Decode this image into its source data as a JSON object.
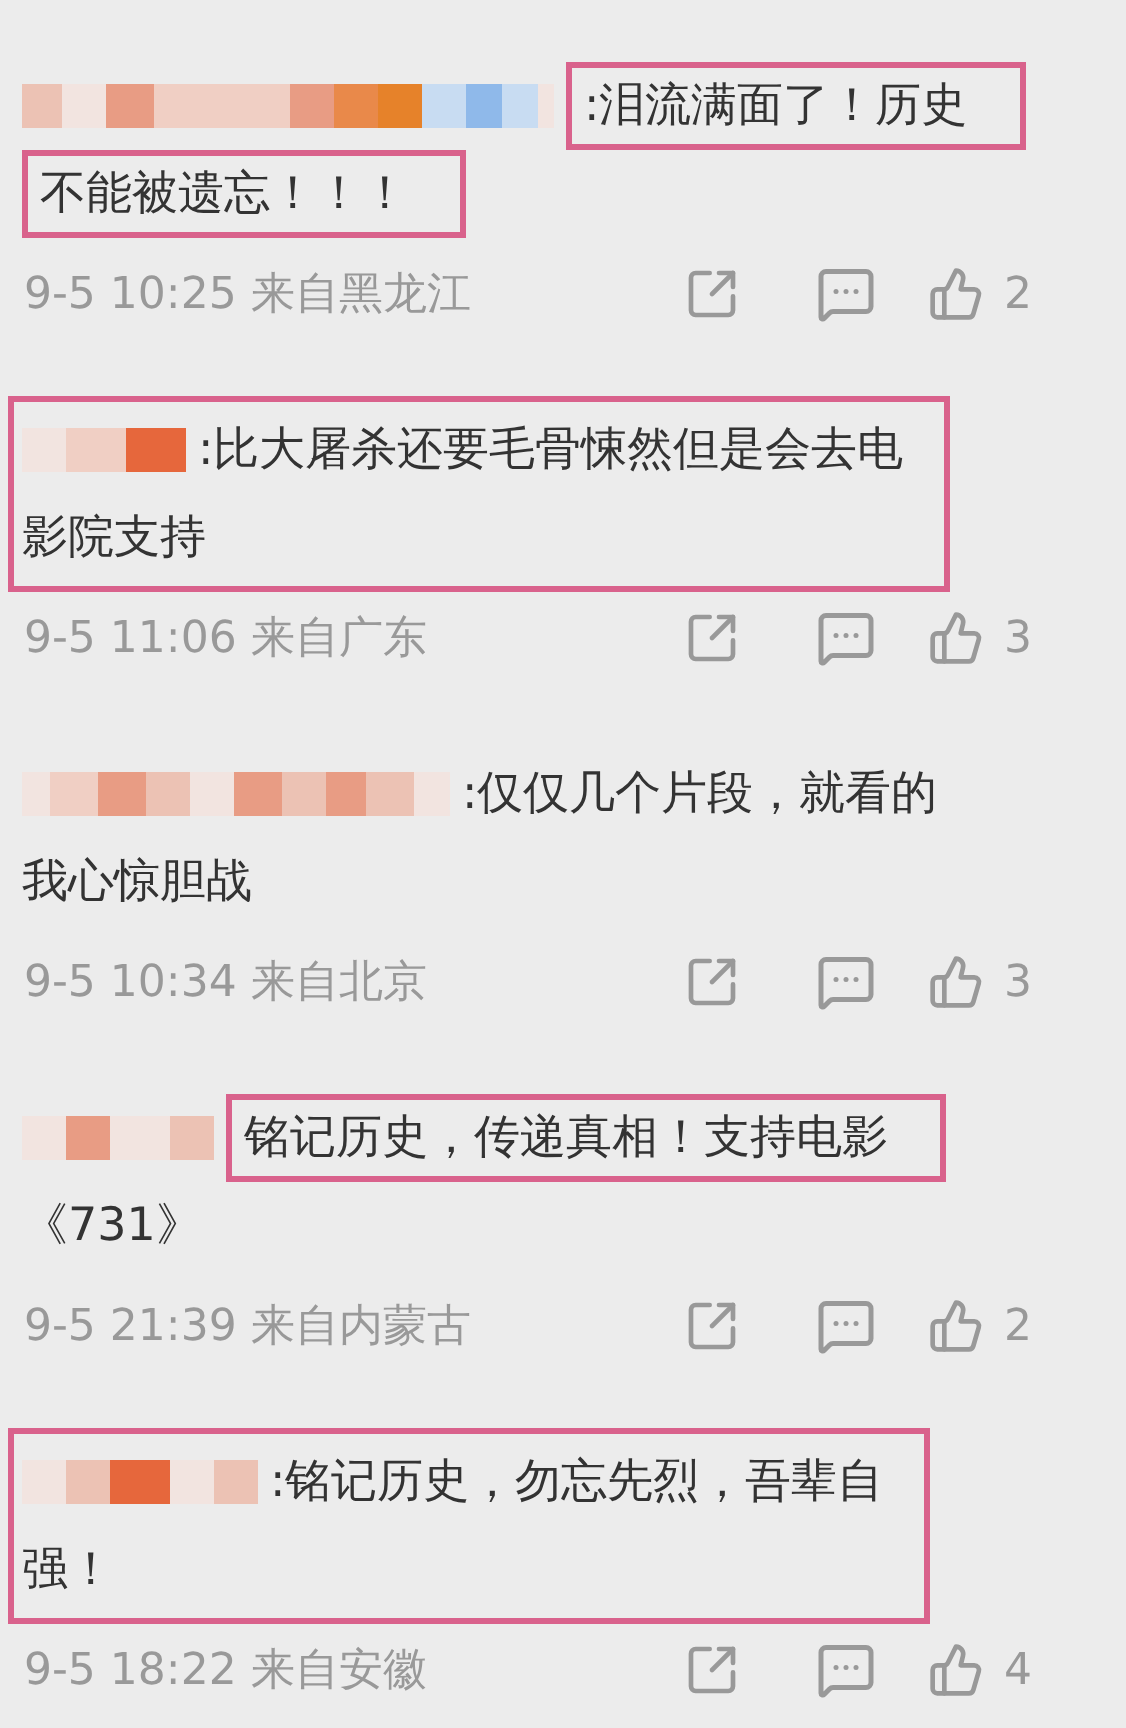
{
  "comments": [
    {
      "author": {
        "kind": "pixelated"
      },
      "merged": false,
      "lines": [
        {
          "text": ":泪流满面了！历史",
          "marked": true
        },
        {
          "text": "不能被遗忘！！！",
          "marked": true
        }
      ],
      "meta": "9-5 10:25 来自黑龙江",
      "likes": "2"
    },
    {
      "author": {
        "kind": "pixelated"
      },
      "merged": true,
      "lines": [
        {
          "text": ":比大屠杀还要毛骨悚然但是会去电"
        },
        {
          "text": "影院支持"
        }
      ],
      "meta": "9-5 11:06 来自广东",
      "likes": "3"
    },
    {
      "author": {
        "kind": "pixelated"
      },
      "merged": false,
      "lines": [
        {
          "text": ":仅仅几个片段，就看的",
          "marked": false
        },
        {
          "text": "我心惊胆战",
          "marked": false
        }
      ],
      "meta": "9-5 10:34 来自北京",
      "likes": "3"
    },
    {
      "author": {
        "kind": "pixelated"
      },
      "merged": false,
      "lines": [
        {
          "text": "铭记历史，传递真相！支持电影",
          "marked": true
        },
        {
          "text": "《731》",
          "marked": false
        }
      ],
      "meta": "9-5 21:39 来自内蒙古",
      "likes": "2"
    },
    {
      "author": {
        "kind": "pixelated"
      },
      "merged": true,
      "lines": [
        {
          "text": ":铭记历史，勿忘先烈，吾辈自"
        },
        {
          "text": "强！"
        }
      ],
      "meta": "9-5 18:22 来自安徽",
      "likes": "4"
    }
  ]
}
